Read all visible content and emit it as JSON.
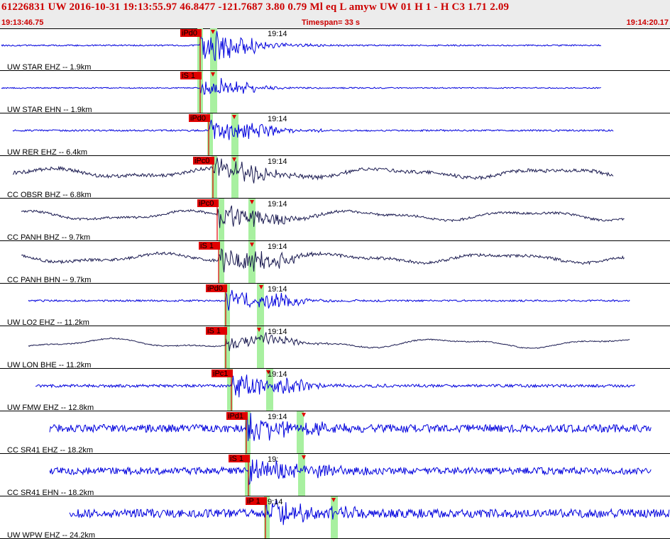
{
  "header": {
    "line1": "61226831 UW 2016-10-31 19:13:55.97   46.8477 -121.7687   3.80  0.79 Ml  eq  L amyw     UW 01  H   1  -  H C3    1.71  2.09",
    "start_time": "19:13:46.75",
    "timespan": "Timespan=  33 s",
    "end_time": "19:14:20.17"
  },
  "colors": {
    "header_text": "#cc0000",
    "trace_blue": "#0000dd",
    "trace_dark": "#1a1a50",
    "pick_green": "#a8f0a0",
    "pick_red": "#e00000",
    "divider": "#000000"
  },
  "channels": [
    {
      "label": "UW STAR EHZ -- 1.9km",
      "time_mark": "19:14",
      "pick": "iPd0",
      "color": "blue",
      "amplitude": 0.55,
      "noise": 0.05
    },
    {
      "label": "UW STAR EHN -- 1.9km",
      "time_mark": "",
      "pick": "iS 1",
      "color": "blue",
      "amplitude": 0.3,
      "noise": 0.04
    },
    {
      "label": "UW RER EHZ -- 6.4km",
      "time_mark": "19:14",
      "pick": "iPd0",
      "color": "blue",
      "amplitude": 0.45,
      "noise": 0.06
    },
    {
      "label": "CC OBSR BHZ -- 6.8km",
      "time_mark": "19:14",
      "pick": "iPc0",
      "color": "dark",
      "amplitude": 0.4,
      "noise": 0.12
    },
    {
      "label": "CC PANH BHZ -- 9.7km",
      "time_mark": "19:14",
      "pick": "iPc0",
      "color": "dark",
      "amplitude": 0.5,
      "noise": 0.08
    },
    {
      "label": "CC PANH BHN -- 9.7km",
      "time_mark": "19:14",
      "pick": "iS 1",
      "color": "dark",
      "amplitude": 0.55,
      "noise": 0.1
    },
    {
      "label": "UW LO2 EHZ -- 11.2km",
      "time_mark": "19:14",
      "pick": "iPd0",
      "color": "blue",
      "amplitude": 0.5,
      "noise": 0.06
    },
    {
      "label": "UW LON BHE -- 11.2km",
      "time_mark": "19:14",
      "pick": "iS 1",
      "color": "dark",
      "amplitude": 0.3,
      "noise": 0.04
    },
    {
      "label": "UW FMW EHZ -- 12.8km",
      "time_mark": "19:14",
      "pick": "iPc1",
      "color": "blue",
      "amplitude": 0.5,
      "noise": 0.1
    },
    {
      "label": "CC SR41 EHZ -- 18.2km",
      "time_mark": "19:14",
      "pick": "iPd1",
      "color": "blue",
      "amplitude": 0.6,
      "noise": 0.28
    },
    {
      "label": "CC SR41 EHN -- 18.2km",
      "time_mark": "19:",
      "pick": "iS 1",
      "color": "blue",
      "amplitude": 0.6,
      "noise": 0.25
    },
    {
      "label": "UW WPW EHZ -- 24.2km",
      "time_mark": "9:14",
      "pick": "iP 1",
      "color": "blue",
      "amplitude": 0.65,
      "noise": 0.3
    }
  ]
}
